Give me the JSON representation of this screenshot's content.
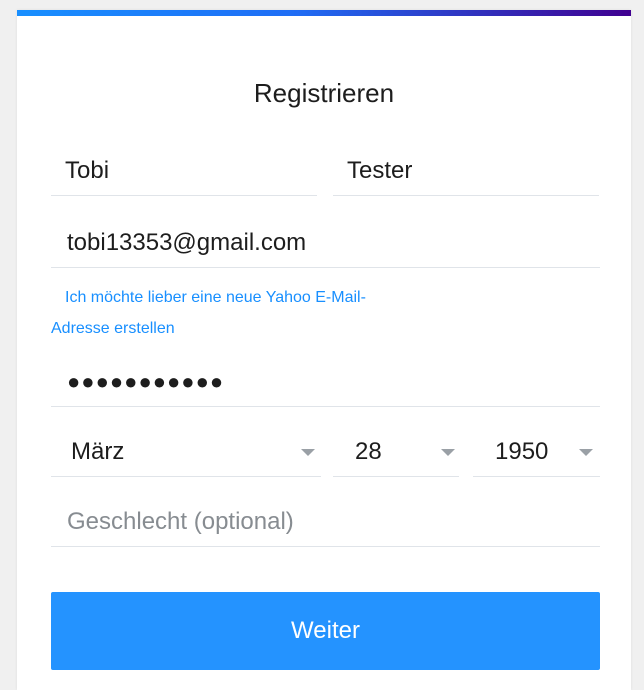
{
  "form": {
    "title": "Registrieren",
    "first_name": "Tobi",
    "last_name": "Tester",
    "email": "tobi13353@gmail.com",
    "yahoo_link_line1": "Ich möchte lieber eine neue Yahoo E-Mail-",
    "yahoo_link_line2": "Adresse erstellen",
    "password_mask": "●●●●●●●●●●●",
    "birth_month": "März",
    "birth_day": "28",
    "birth_year": "1950",
    "gender_placeholder": "Geschlecht (optional)",
    "submit_label": "Weiter"
  },
  "colors": {
    "accent": "#188fff",
    "button": "#2493ff",
    "gradient_end": "#400090"
  },
  "icons": {
    "dropdown": "chevron-down-icon"
  }
}
